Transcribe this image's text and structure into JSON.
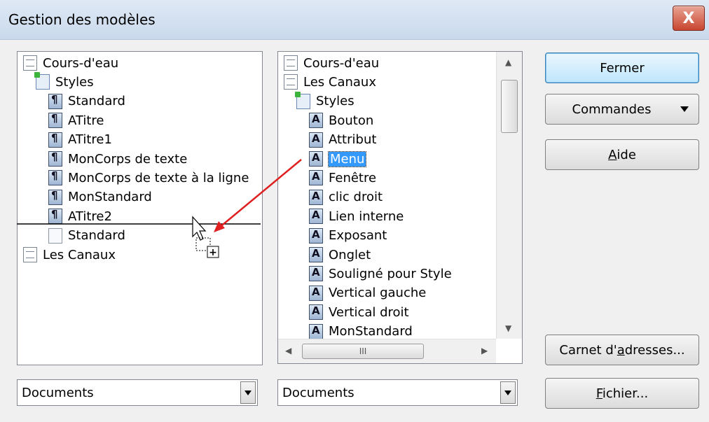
{
  "window": {
    "title": "Gestion des modèles",
    "close_label": "X"
  },
  "left_tree": [
    {
      "label": "Cours-d'eau",
      "icon": "document-icon",
      "level": 0
    },
    {
      "label": "Styles",
      "icon": "styles-folder-icon",
      "level": 1
    },
    {
      "label": "Standard",
      "icon": "paragraph-style-icon",
      "level": 2
    },
    {
      "label": "ATitre",
      "icon": "paragraph-style-icon",
      "level": 2
    },
    {
      "label": "ATitre1",
      "icon": "paragraph-style-icon",
      "level": 2
    },
    {
      "label": "MonCorps de texte",
      "icon": "paragraph-style-icon",
      "level": 2
    },
    {
      "label": "MonCorps de texte à la ligne",
      "icon": "paragraph-style-icon",
      "level": 2
    },
    {
      "label": "MonStandard",
      "icon": "paragraph-style-icon",
      "level": 2
    },
    {
      "label": "ATitre2",
      "icon": "paragraph-style-icon",
      "level": 2
    },
    {
      "label": "Standard",
      "icon": "ghost-style-icon",
      "level": 2
    },
    {
      "label": "Les Canaux",
      "icon": "document-icon",
      "level": 0
    }
  ],
  "right_tree": [
    {
      "label": "Cours-d'eau",
      "icon": "document-icon",
      "level": 0
    },
    {
      "label": "Les Canaux",
      "icon": "document-icon",
      "level": 0
    },
    {
      "label": "Styles",
      "icon": "styles-folder-icon",
      "level": 1
    },
    {
      "label": "Bouton",
      "icon": "character-style-icon",
      "level": 2
    },
    {
      "label": "Attribut",
      "icon": "character-style-icon",
      "level": 2
    },
    {
      "label": "Menu",
      "icon": "character-style-icon",
      "level": 2,
      "selected": true
    },
    {
      "label": "Fenêtre",
      "icon": "character-style-icon",
      "level": 2
    },
    {
      "label": "clic droit",
      "icon": "character-style-icon",
      "level": 2
    },
    {
      "label": "Lien interne",
      "icon": "character-style-icon",
      "level": 2
    },
    {
      "label": "Exposant",
      "icon": "character-style-icon",
      "level": 2
    },
    {
      "label": "Onglet",
      "icon": "character-style-icon",
      "level": 2
    },
    {
      "label": "Souligné pour Style",
      "icon": "character-style-icon",
      "level": 2
    },
    {
      "label": "Vertical gauche",
      "icon": "character-style-icon",
      "level": 2
    },
    {
      "label": "Vertical droit",
      "icon": "character-style-icon",
      "level": 2
    },
    {
      "label": "MonStandard",
      "icon": "character-style-icon",
      "level": 2
    }
  ],
  "scrollbar": {
    "grip_label": "III"
  },
  "buttons": {
    "fermer": "Fermer",
    "commandes": "Commandes",
    "aide_first": "A",
    "aide_rest": "ide",
    "carnet_pre": "Carnet d'",
    "carnet_ul": "a",
    "carnet_post": "dresses...",
    "fichier_ul": "F",
    "fichier_rest": "ichier..."
  },
  "combos": {
    "left": "Documents",
    "right": "Documents"
  },
  "colors": {
    "selection": "#3399ff",
    "drag_arrow": "#e02020",
    "close_button": "#c8452f"
  }
}
